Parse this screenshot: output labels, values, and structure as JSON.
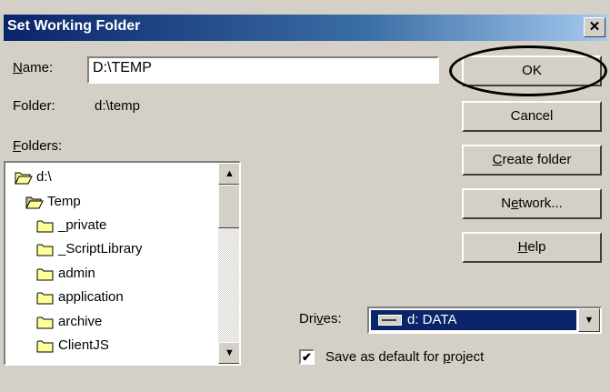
{
  "window": {
    "title": "Set Working Folder",
    "close_glyph": "✕"
  },
  "name_field": {
    "label_key": "N",
    "label_rest": "ame:",
    "value": "D:\\TEMP"
  },
  "folder": {
    "label": "Folder:",
    "value": "d:\\temp"
  },
  "folders": {
    "label_key": "F",
    "label_rest": "olders:",
    "items": [
      {
        "label": "d:\\",
        "icon": "folder-open-icon"
      },
      {
        "label": "Temp",
        "icon": "folder-open-icon"
      },
      {
        "label": "_private",
        "icon": "folder-icon"
      },
      {
        "label": "_ScriptLibrary",
        "icon": "folder-icon"
      },
      {
        "label": "admin",
        "icon": "folder-icon"
      },
      {
        "label": "application",
        "icon": "folder-icon"
      },
      {
        "label": "archive",
        "icon": "folder-icon"
      },
      {
        "label": "ClientJS",
        "icon": "folder-icon"
      }
    ]
  },
  "buttons": {
    "ok": "OK",
    "cancel": "Cancel",
    "create_key": "C",
    "create_rest": "reate folder",
    "network_pre": "N",
    "network_key": "e",
    "network_rest": "twork...",
    "help_key": "H",
    "help_rest": "elp"
  },
  "drives": {
    "label_pre": "Dri",
    "label_key": "v",
    "label_rest": "es:",
    "selected": "d: DATA"
  },
  "save_default": {
    "checked": true,
    "check_glyph": "✔",
    "label_pre": "Save as default for ",
    "label_key": "p",
    "label_rest": "roject"
  },
  "colors": {
    "title_start": "#0a246a",
    "selection": "#0a246a",
    "face": "#d4d0c8",
    "folder_yellow": "#ffff99"
  }
}
